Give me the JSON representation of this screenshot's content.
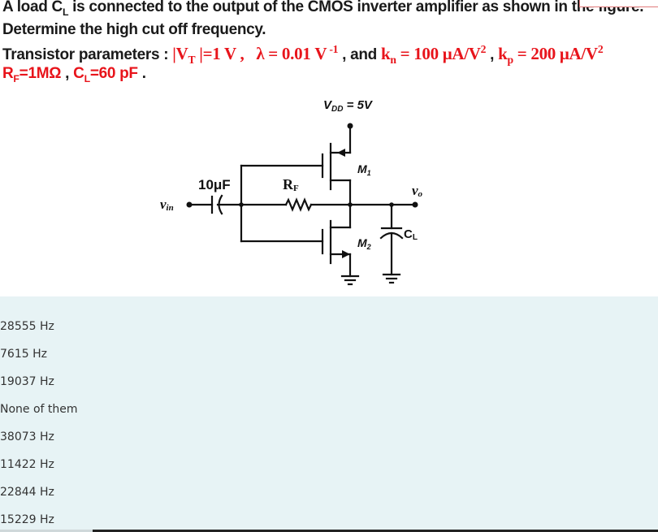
{
  "question": {
    "line1": "A load C",
    "line1_sub": "L",
    "line1_rest": " is connected to the output of the CMOS inverter amplifier as shown in the figure.",
    "line2": "Determine the high cut off frequency.",
    "line3_label": "Transistor parameters : ",
    "vt": "|V",
    "vt_sub": "T",
    "vt_rest": " |=1 V ,",
    "lambda": "λ = 0.01 V",
    "lambda_sup": " -1",
    "and_text": " , and ",
    "kn": "k",
    "kn_sub": "n",
    "kn_rest": " = 100 μA/V",
    "kn_sup": "2",
    "kp_sep": " , ",
    "kp": "k",
    "kp_sub": "p",
    "kp_rest": " = 200 μA/V",
    "kp_sup": "2",
    "rf": "R",
    "rf_sub": "F",
    "rf_rest": "=1MΩ",
    "cl_sep": " , ",
    "cl": "C",
    "cl_sub": "L",
    "cl_rest": "=60 pF",
    "end": " ."
  },
  "circuit": {
    "vdd_label": "V",
    "vdd_sub": "DD",
    "vdd_rest": " = 5V",
    "m1_label": "M",
    "m1_sub": "1",
    "m2_label": "M",
    "m2_sub": "2",
    "cap_label": "10μF",
    "rf_label": "R",
    "rf_sub": "F",
    "vin_label": "v",
    "vin_sub": "in",
    "vo_label": "v",
    "vo_sub": "o",
    "cl_label": "C",
    "cl_sub": "L"
  },
  "answers": [
    "28555 Hz",
    "7615 Hz",
    "19037 Hz",
    "None of them",
    "38073 Hz",
    "11422 Hz",
    "22844 Hz",
    "15229 Hz"
  ],
  "colors": {
    "accent_red": "#e8141b",
    "answers_background": "#e7f3f5"
  }
}
